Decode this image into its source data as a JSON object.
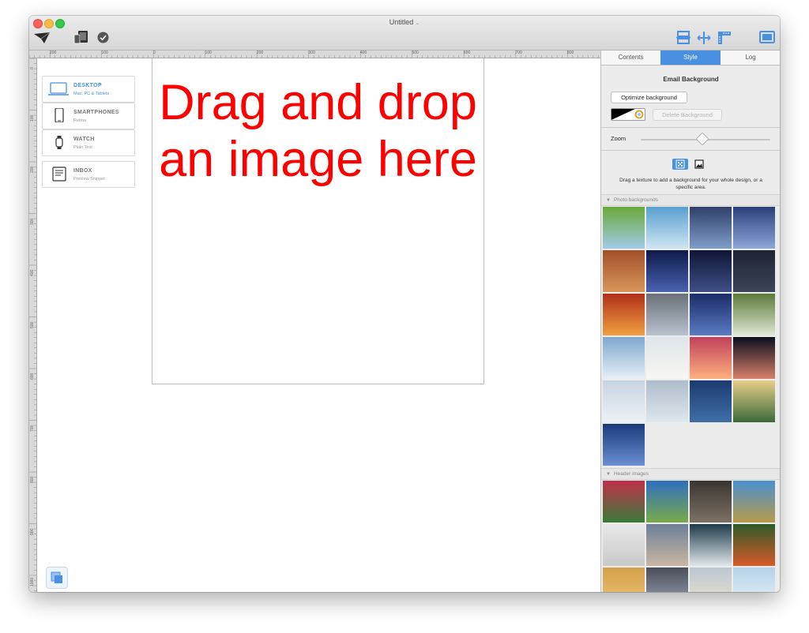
{
  "window": {
    "title": "Untitled"
  },
  "ruler": {
    "top_labels": [
      "200",
      "100",
      "0",
      "100",
      "200",
      "300",
      "400",
      "500",
      "600",
      "700",
      "800"
    ],
    "left_labels": [
      "0",
      "100",
      "200",
      "300",
      "400",
      "500",
      "600",
      "700",
      "800",
      "900",
      "1000"
    ]
  },
  "devices": [
    {
      "name": "DESKTOP",
      "sub": "Mac, PC & Tablets",
      "icon": "laptop-icon",
      "active": true
    },
    {
      "name": "SMARTPHONES",
      "sub": "Retina",
      "icon": "smartphone-icon",
      "active": false
    },
    {
      "name": "WATCH",
      "sub": "Plain Text",
      "icon": "watch-icon",
      "active": false
    },
    {
      "name": "INBOX",
      "sub": "Preview Snippet",
      "icon": "inbox-icon",
      "active": false
    }
  ],
  "canvas": {
    "dropmsg": "Drag and drop an image here"
  },
  "panel": {
    "tabs": [
      "Contents",
      "Style",
      "Log"
    ],
    "active_tab": "Style",
    "bg_title": "Email Background",
    "optimize_label": "Optimize background",
    "delete_label": "Delete Background",
    "zoom_label": "Zoom",
    "zoom_level": 0.47,
    "hint": "Drag a texture to add a background for your whole design, or a specific area.",
    "photo_section": "Photo backgrounds",
    "header_section": "Header images"
  },
  "colors": {
    "accent": "#4a90e2",
    "dropmsg": "#ff0000"
  },
  "photo_backgrounds": [
    [
      "#6aa83a",
      "#9fcbe8"
    ],
    [
      "#5a9fd0",
      "#cfe6f2"
    ],
    [
      "#2f3f6a",
      "#7f9ec9"
    ],
    [
      "#2a3f7a",
      "#8da8d8"
    ],
    [
      "#a2502a",
      "#d8965a"
    ],
    [
      "#0d1a4a",
      "#4a63b0"
    ],
    [
      "#0f1535",
      "#3e4f86"
    ],
    [
      "#1e2433",
      "#3b4458"
    ],
    [
      "#b0301a",
      "#f0a040"
    ],
    [
      "#6a7077",
      "#b8c3cf"
    ],
    [
      "#1b2c66",
      "#5b7bc4"
    ],
    [
      "#5c7a3a",
      "#dfe6d2"
    ],
    [
      "#7fa8cf",
      "#e6eef6"
    ],
    [
      "#dfe5ea",
      "#f7f7f2"
    ],
    [
      "#c0405a",
      "#ffb080"
    ],
    [
      "#0c0f1e",
      "#d8806a"
    ],
    [
      "#c6d4e2",
      "#edf1f4"
    ],
    [
      "#aebccb",
      "#dfe7ee"
    ],
    [
      "#1c3b6e",
      "#3f6ea8"
    ],
    [
      "#e6cf8a",
      "#3c6a3a"
    ],
    [
      "#1b3a7a",
      "#6a8fd2"
    ]
  ],
  "header_images": [
    [
      "#c0304a",
      "#3a7a3a"
    ],
    [
      "#2f6fbf",
      "#7aaa4a"
    ],
    [
      "#3a3530",
      "#7d7165"
    ],
    [
      "#4a90d0",
      "#b89a4a"
    ],
    [
      "#e8e8e8",
      "#c9c9c9"
    ],
    [
      "#6d7f98",
      "#c9b7a3"
    ],
    [
      "#1f3a4a",
      "#dfe7ea"
    ],
    [
      "#2f5a2a",
      "#d85a2a"
    ],
    [
      "#d2a04a",
      "#f1c777"
    ],
    [
      "#4a4e5a",
      "#9ea7b5"
    ],
    [
      "#bcc7d3",
      "#efe3cd"
    ],
    [
      "#b4d2e8",
      "#eef4f8"
    ]
  ]
}
